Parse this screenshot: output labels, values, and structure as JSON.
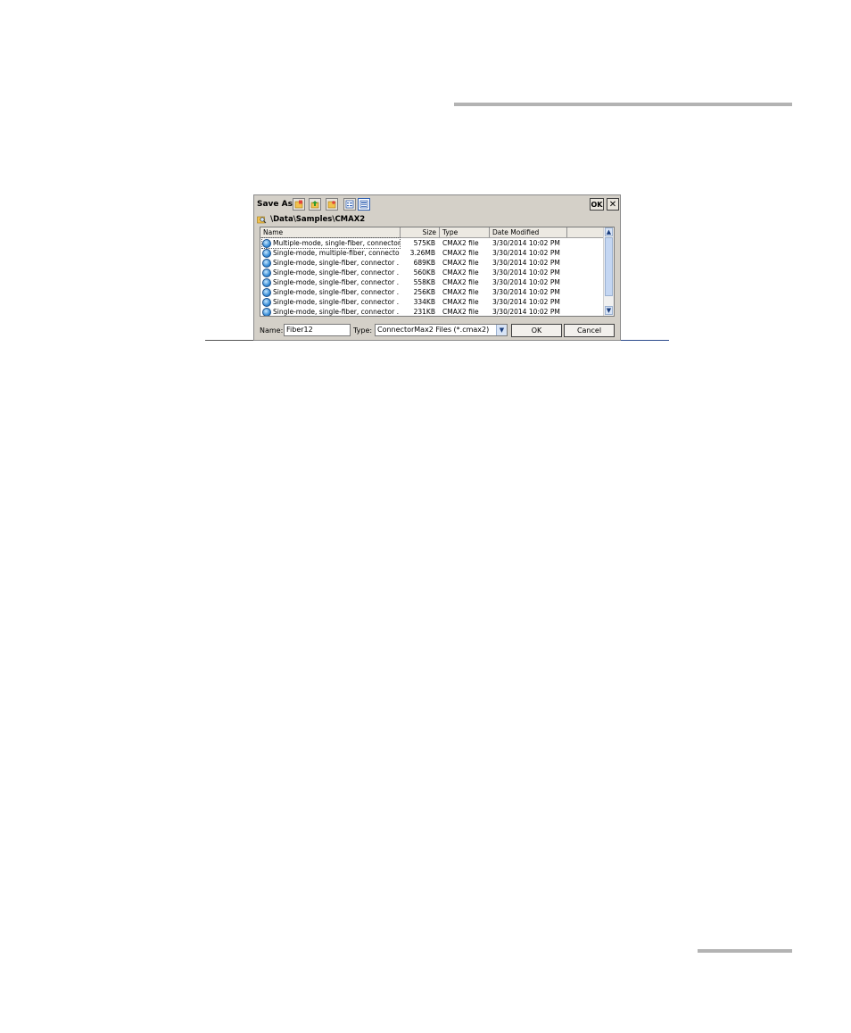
{
  "dialog": {
    "title": "Save As",
    "toolbar_icons": [
      "new-folder-icon",
      "up-folder-icon",
      "folder-open-icon",
      "list-view-icon",
      "details-view-icon"
    ],
    "ok_top_label": "OK",
    "close_label": "✕",
    "path": "\\Data\\Samples\\CMAX2"
  },
  "list": {
    "columns": {
      "name": "Name",
      "size": "Size",
      "type": "Type",
      "date": "Date Modified"
    },
    "rows": [
      {
        "name": "Multiple-mode, single-fiber, connector…",
        "size": "575KB",
        "type": "CMAX2 file",
        "date": "3/30/2014 10:02 PM"
      },
      {
        "name": "Single-mode, multiple-fiber, connecto…",
        "size": "3.26MB",
        "type": "CMAX2 file",
        "date": "3/30/2014 10:02 PM"
      },
      {
        "name": "Single-mode, single-fiber, connector …",
        "size": "689KB",
        "type": "CMAX2 file",
        "date": "3/30/2014 10:02 PM"
      },
      {
        "name": "Single-mode, single-fiber, connector …",
        "size": "560KB",
        "type": "CMAX2 file",
        "date": "3/30/2014 10:02 PM"
      },
      {
        "name": "Single-mode, single-fiber, connector …",
        "size": "558KB",
        "type": "CMAX2 file",
        "date": "3/30/2014 10:02 PM"
      },
      {
        "name": "Single-mode, single-fiber, connector …",
        "size": "256KB",
        "type": "CMAX2 file",
        "date": "3/30/2014 10:02 PM"
      },
      {
        "name": "Single-mode, single-fiber, connector …",
        "size": "334KB",
        "type": "CMAX2 file",
        "date": "3/30/2014 10:02 PM"
      },
      {
        "name": "Single-mode, single-fiber, connector …",
        "size": "231KB",
        "type": "CMAX2 file",
        "date": "3/30/2014 10:02 PM"
      }
    ]
  },
  "bottom": {
    "name_label": "Name:",
    "name_value": "Fiber12",
    "type_label": "Type:",
    "type_value": "ConnectorMax2 Files (*.cmax2)",
    "ok_label": "OK",
    "cancel_label": "Cancel"
  },
  "colors": {
    "dialog_bg": "#d4d0c8",
    "selection_accent": "#2f5fb0"
  }
}
